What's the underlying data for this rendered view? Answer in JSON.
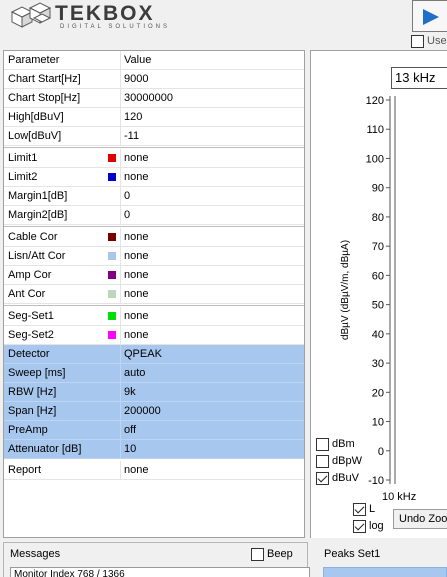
{
  "header": {
    "logo_text": "TEKBOX",
    "logo_subtitle": "DIGITAL SOLUTIONS",
    "use_label": "Use"
  },
  "grid": {
    "col_param": "Parameter",
    "col_value": "Value",
    "rows": [
      {
        "name": "Chart Start[Hz]",
        "value": "9000"
      },
      {
        "name": "Chart Stop[Hz]",
        "value": "30000000"
      },
      {
        "name": "High[dBuV]",
        "value": "120"
      },
      {
        "name": "Low[dBuV]",
        "value": "-11"
      },
      {
        "name": "Limit1",
        "value": "none",
        "swatch": "#e00000"
      },
      {
        "name": "Limit2",
        "value": "none",
        "swatch": "#0000c8"
      },
      {
        "name": "Margin1[dB]",
        "value": "0"
      },
      {
        "name": "Margin2[dB]",
        "value": "0"
      },
      {
        "name": "Cable Cor",
        "value": "none",
        "swatch": "#7a0000"
      },
      {
        "name": "Lisn/Att Cor",
        "value": "none",
        "swatch": "#a8c8e8"
      },
      {
        "name": "Amp Cor",
        "value": "none",
        "swatch": "#800080"
      },
      {
        "name": "Ant Cor",
        "value": "none",
        "swatch": "#bcd8bc"
      },
      {
        "name": "Seg-Set1",
        "value": "none",
        "swatch": "#00e000"
      },
      {
        "name": "Seg-Set2",
        "value": "none",
        "swatch": "#ff00ff"
      },
      {
        "name": "Detector",
        "value": "QPEAK"
      },
      {
        "name": "Sweep [ms]",
        "value": "auto"
      },
      {
        "name": "RBW [Hz]",
        "value": "9k"
      },
      {
        "name": "Span [Hz]",
        "value": "200000"
      },
      {
        "name": "PreAmp",
        "value": "off"
      },
      {
        "name": "Attenuator [dB]",
        "value": "10"
      },
      {
        "name": "Report",
        "value": "none"
      }
    ]
  },
  "chart": {
    "freq_display": "13 kHz",
    "ylabel": "dBµV  (dBµV/m, dBµA)",
    "xtick": "10 kHz",
    "units": [
      {
        "label": "dBm",
        "checked": false
      },
      {
        "label": "dBpW",
        "checked": false
      },
      {
        "label": "dBuV",
        "checked": true
      }
    ],
    "opt_l": "L",
    "opt_log": "log",
    "undo_label": "Undo Zoom"
  },
  "chart_data": {
    "type": "line",
    "ylabel": "dBµV  (dBµV/m, dBµA)",
    "yticks": [
      120,
      110,
      100,
      90,
      80,
      70,
      60,
      50,
      40,
      30,
      20,
      10,
      0,
      -10
    ],
    "ylim": [
      -11,
      120
    ],
    "xticks": [
      "10 kHz"
    ],
    "grid": true,
    "series": []
  },
  "bottom": {
    "messages_title": "Messages",
    "beep_label": "Beep",
    "message_text": "Monitor Index 768 / 1366",
    "peaks_title": "Peaks Set1"
  }
}
